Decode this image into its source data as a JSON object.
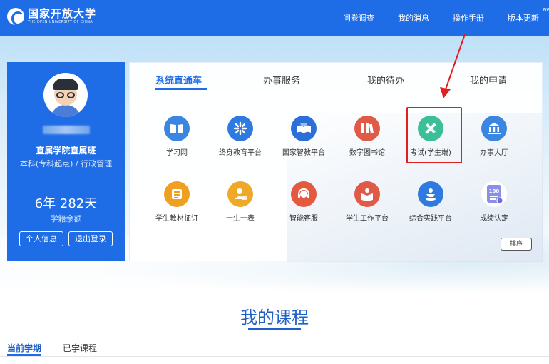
{
  "header": {
    "logo_cn": "国家开放大学",
    "logo_en": "THE OPEN UNIVERSITY OF CHINA",
    "nav": [
      "问卷调查",
      "我的消息",
      "操作手册",
      "版本更新"
    ],
    "new_badge": "NEW"
  },
  "profile": {
    "school": "直属学院直属班",
    "major": "本科(专科起点) / 行政管理",
    "years": "6年 282天",
    "years_label": "学籍余额",
    "info_button": "个人信息",
    "logout_button": "退出登录"
  },
  "tabs": [
    "系统直通车",
    "办事服务",
    "我的待办",
    "我的申请"
  ],
  "apps": [
    {
      "label": "学习网",
      "color": "#3a86e0",
      "icon": "book-icon"
    },
    {
      "label": "终身教育平台",
      "color": "#2f7ae0",
      "icon": "snowflake-icon"
    },
    {
      "label": "国家智教平台",
      "color": "#2b6fd8",
      "icon": "open-book-icon"
    },
    {
      "label": "数字图书馆",
      "color": "#e05a48",
      "icon": "library-books-icon"
    },
    {
      "label": "考试(学生端)",
      "color": "#3bbf98",
      "icon": "pencil-ruler-icon"
    },
    {
      "label": "办事大厅",
      "color": "#3a86e0",
      "icon": "hall-building-icon"
    },
    {
      "label": "学生教材征订",
      "color": "#f0a020",
      "icon": "textbook-list-icon"
    },
    {
      "label": "一生一表",
      "color": "#f0a828",
      "icon": "person-form-icon"
    },
    {
      "label": "智能客服",
      "color": "#e45a40",
      "icon": "headset-icon"
    },
    {
      "label": "学生工作平台",
      "color": "#e05a48",
      "icon": "reader-icon"
    },
    {
      "label": "综合实践平台",
      "color": "#2f7ae0",
      "icon": "practice-person-icon"
    },
    {
      "label": "成绩认定",
      "color": "#8a8fe8",
      "icon": "score-100-icon"
    }
  ],
  "sort_button": "排序",
  "courses": {
    "title": "我的课程",
    "tabs": [
      "当前学期",
      "已学课程"
    ]
  }
}
